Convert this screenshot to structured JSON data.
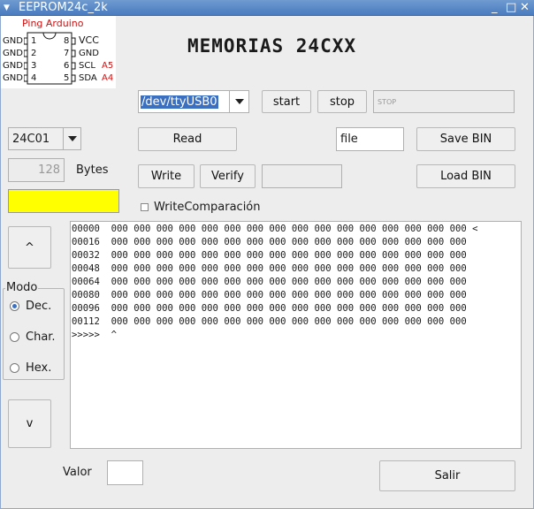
{
  "window": {
    "title": "EEPROM24c_2k",
    "menu_glyph": "▼",
    "minimize_glyph": "_",
    "maximize_glyph": "□",
    "close_glyph": "✕"
  },
  "pin_diagram": {
    "title": "Ping Arduino",
    "left": [
      {
        "label": "GND",
        "pin": "1"
      },
      {
        "label": "GND",
        "pin": "2"
      },
      {
        "label": "GND",
        "pin": "3"
      },
      {
        "label": "GND",
        "pin": "4"
      }
    ],
    "right": [
      {
        "pin": "8",
        "label": "VCC",
        "arduino": ""
      },
      {
        "pin": "7",
        "label": "GND",
        "arduino": ""
      },
      {
        "pin": "6",
        "label": "SCL",
        "arduino": "A5"
      },
      {
        "pin": "5",
        "label": "SDA",
        "arduino": "A4"
      }
    ]
  },
  "header": {
    "title": "MEMORIAS 24CXX"
  },
  "port": {
    "selected": "/dev/ttyUSB0",
    "start_label": "start",
    "stop_label": "stop",
    "status": "STOP"
  },
  "chip": {
    "selected": "24C01",
    "size_value": "128",
    "size_unit": "Bytes",
    "indicator_color": "#ffff00"
  },
  "actions": {
    "read_label": "Read",
    "write_label": "Write",
    "verify_label": "Verify",
    "verify_result": "",
    "file_value": "file",
    "save_label": "Save BIN",
    "load_label": "Load BIN",
    "write_compare_label": "WriteComparación"
  },
  "nav": {
    "up_label": "^",
    "down_label": "v"
  },
  "mode": {
    "title": "Modo",
    "options": [
      "Dec.",
      "Char.",
      "Hex."
    ],
    "selected": "Dec."
  },
  "memory": {
    "rows": [
      {
        "addr": "00000",
        "bytes": [
          "000",
          "000",
          "000",
          "000",
          "000",
          "000",
          "000",
          "000",
          "000",
          "000",
          "000",
          "000",
          "000",
          "000",
          "000",
          "000"
        ],
        "marker": "<"
      },
      {
        "addr": "00016",
        "bytes": [
          "000",
          "000",
          "000",
          "000",
          "000",
          "000",
          "000",
          "000",
          "000",
          "000",
          "000",
          "000",
          "000",
          "000",
          "000",
          "000"
        ],
        "marker": ""
      },
      {
        "addr": "00032",
        "bytes": [
          "000",
          "000",
          "000",
          "000",
          "000",
          "000",
          "000",
          "000",
          "000",
          "000",
          "000",
          "000",
          "000",
          "000",
          "000",
          "000"
        ],
        "marker": ""
      },
      {
        "addr": "00048",
        "bytes": [
          "000",
          "000",
          "000",
          "000",
          "000",
          "000",
          "000",
          "000",
          "000",
          "000",
          "000",
          "000",
          "000",
          "000",
          "000",
          "000"
        ],
        "marker": ""
      },
      {
        "addr": "00064",
        "bytes": [
          "000",
          "000",
          "000",
          "000",
          "000",
          "000",
          "000",
          "000",
          "000",
          "000",
          "000",
          "000",
          "000",
          "000",
          "000",
          "000"
        ],
        "marker": ""
      },
      {
        "addr": "00080",
        "bytes": [
          "000",
          "000",
          "000",
          "000",
          "000",
          "000",
          "000",
          "000",
          "000",
          "000",
          "000",
          "000",
          "000",
          "000",
          "000",
          "000"
        ],
        "marker": ""
      },
      {
        "addr": "00096",
        "bytes": [
          "000",
          "000",
          "000",
          "000",
          "000",
          "000",
          "000",
          "000",
          "000",
          "000",
          "000",
          "000",
          "000",
          "000",
          "000",
          "000"
        ],
        "marker": ""
      },
      {
        "addr": "00112",
        "bytes": [
          "000",
          "000",
          "000",
          "000",
          "000",
          "000",
          "000",
          "000",
          "000",
          "000",
          "000",
          "000",
          "000",
          "000",
          "000",
          "000"
        ],
        "marker": ""
      }
    ],
    "prompt": ">>>>>",
    "cursor": "^"
  },
  "footer": {
    "valor_label": "Valor",
    "valor_value": "",
    "exit_label": "Salir"
  }
}
